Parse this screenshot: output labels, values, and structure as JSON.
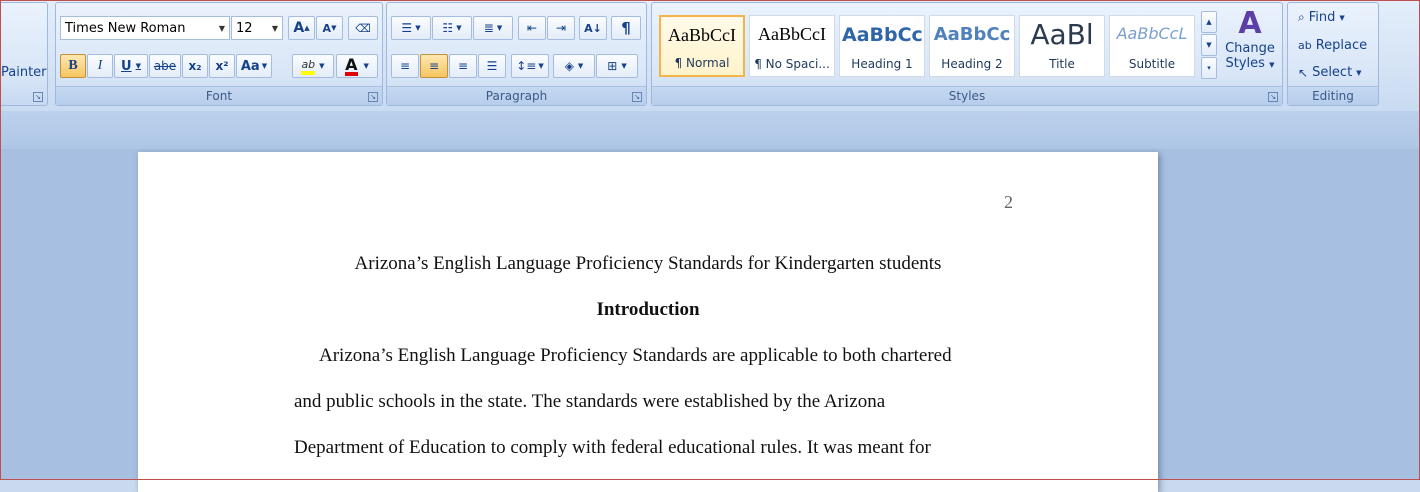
{
  "clipboard": {
    "painter_label": "Painter"
  },
  "font": {
    "group_label": "Font",
    "name": "Times New Roman",
    "size": "12",
    "grow_label": "A",
    "shrink_label": "A",
    "bold": "B",
    "italic": "I",
    "underline": "U",
    "strike": "abe",
    "subscript": "x₂",
    "superscript": "x²",
    "case": "Aa",
    "highlight": "ab",
    "color": "A"
  },
  "paragraph": {
    "group_label": "Paragraph",
    "pilcrow": "¶"
  },
  "styles": {
    "group_label": "Styles",
    "change_styles_line1": "Change",
    "change_styles_line2": "Styles",
    "items": [
      {
        "sample": "AaBbCcI",
        "name": "¶ Normal"
      },
      {
        "sample": "AaBbCcI",
        "name": "¶ No Spaci..."
      },
      {
        "sample": "AaBbCc",
        "name": "Heading 1"
      },
      {
        "sample": "AaBbCc",
        "name": "Heading 2"
      },
      {
        "sample": "AaBl",
        "name": "Title"
      },
      {
        "sample": "AaBbCcL",
        "name": "Subtitle"
      }
    ]
  },
  "editing": {
    "group_label": "Editing",
    "find": "Find",
    "replace": "Replace",
    "select": "Select"
  },
  "document": {
    "page_number": "2",
    "title": "Arizona’s English Language Proficiency Standards for Kindergarten students",
    "heading": "Introduction",
    "lines": [
      "Arizona’s English Language Proficiency Standards are applicable to both chartered",
      "and public schools in the state. The standards were established by the Arizona",
      "Department of Education to comply with federal educational rules.  It was meant for"
    ]
  }
}
